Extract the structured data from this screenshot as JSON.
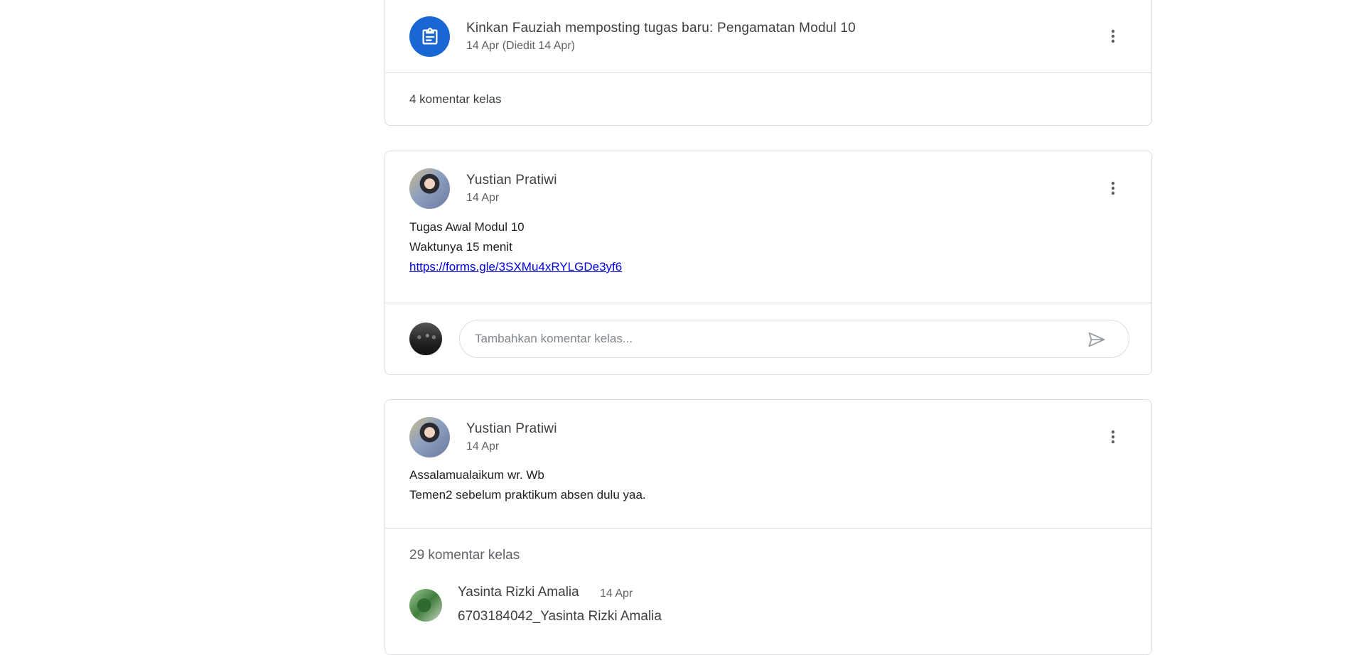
{
  "posts": [
    {
      "author_line": "Kinkan Fauziah memposting tugas baru: Pengamatan Modul 10",
      "date": "14 Apr (Diedit 14 Apr)",
      "icon": "assignment-icon",
      "comment_count": "4 komentar kelas"
    },
    {
      "author": "Yustian Pratiwi",
      "date": "14 Apr",
      "lines": [
        "Tugas Awal Modul 10",
        "Waktunya 15 menit"
      ],
      "link": "https://forms.gle/3SXMu4xRYLGDe3yf6",
      "comment_placeholder": "Tambahkan komentar kelas..."
    },
    {
      "author": "Yustian Pratiwi",
      "date": "14 Apr",
      "lines": [
        "Assalamualaikum wr. Wb",
        "Temen2 sebelum praktikum absen dulu yaa."
      ],
      "comment_count": "29 komentar kelas",
      "first_comment": {
        "author": "Yasinta Rizki Amalia",
        "date": "14 Apr",
        "text": "6703184042_Yasinta Rizki Amalia"
      }
    }
  ],
  "colors": {
    "accent": "#1967d2",
    "border": "#dadce0",
    "link": "#0000ee"
  }
}
